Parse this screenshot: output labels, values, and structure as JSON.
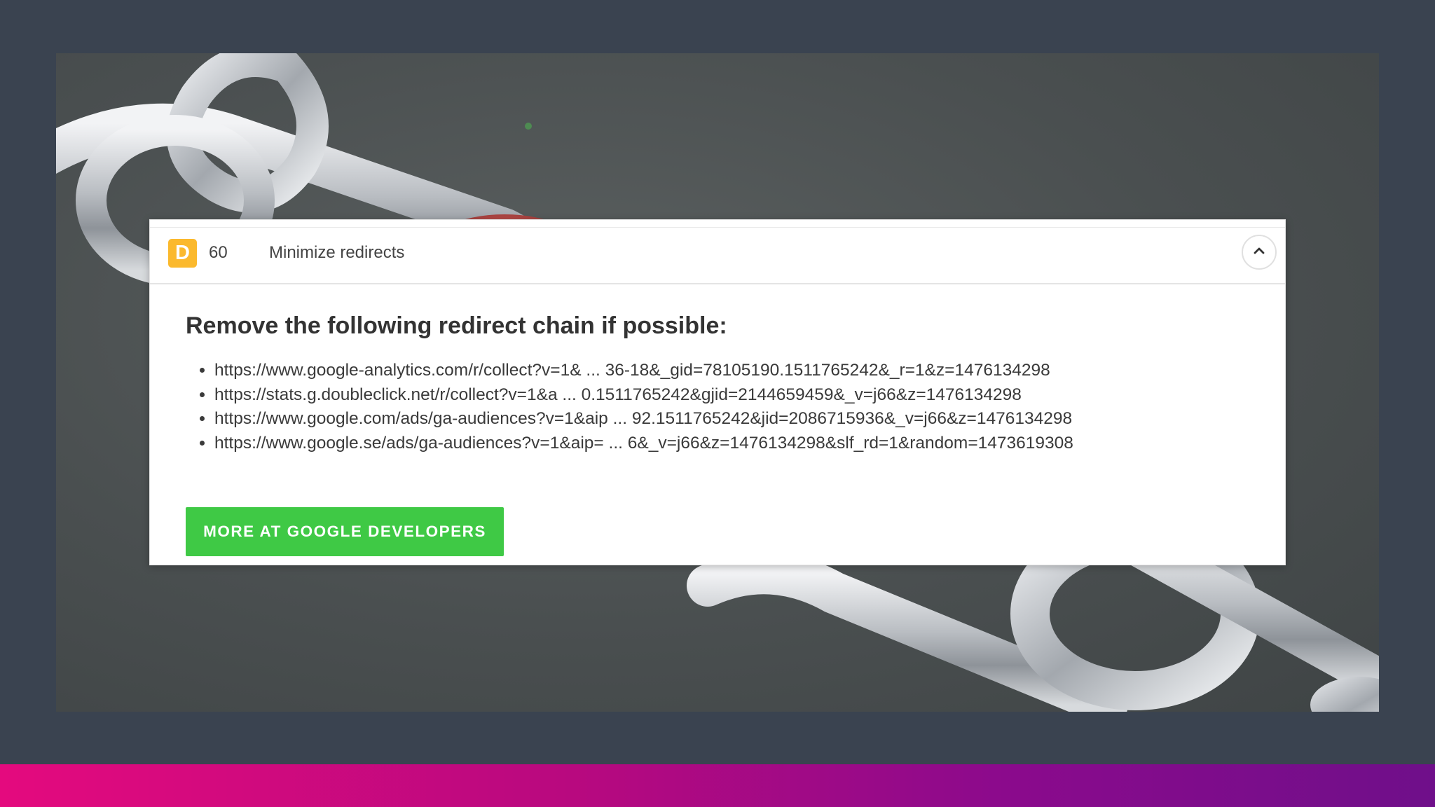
{
  "panel": {
    "grade": "D",
    "score": "60",
    "rule_title": "Minimize redirects",
    "collapse_icon": "chevron-up-icon",
    "heading": "Remove the following redirect chain if possible:",
    "urls": [
      "https://www.google-analytics.com/r/collect?v=1& ... 36-18&_gid=78105190.1511765242&_r=1&z=1476134298",
      "https://stats.g.doubleclick.net/r/collect?v=1&a ... 0.1511765242&gjid=2144659459&_v=j66&z=1476134298",
      "https://www.google.com/ads/ga-audiences?v=1&aip ... 92.1511765242&jid=2086715936&_v=j66&z=1476134298",
      "https://www.google.se/ads/ga-audiences?v=1&aip= ... 6&_v=j66&z=1476134298&slf_rd=1&random=1473619308"
    ],
    "button_label": "MORE AT GOOGLE DEVELOPERS"
  },
  "colors": {
    "grade_badge": "#fbb92d",
    "button": "#3fc945",
    "slide_background": "#3a4350",
    "bar_gradient_start": "#e40a7e",
    "bar_gradient_end": "#6f0f8a"
  }
}
